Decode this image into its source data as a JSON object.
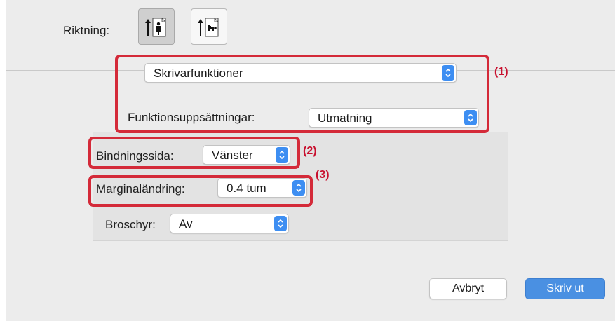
{
  "orientation": {
    "label": "Riktning:",
    "options": [
      {
        "name": "portrait",
        "icon": "portrait-orientation-icon",
        "selected": true
      },
      {
        "name": "landscape",
        "icon": "landscape-orientation-icon",
        "selected": false
      }
    ]
  },
  "section_menu": {
    "value": "Skrivarfunktioner",
    "icon": "popup-arrows-icon"
  },
  "feature_sets": {
    "label": "Funktionsuppsättningar:",
    "value": "Utmatning"
  },
  "binding": {
    "label": "Bindningssida:",
    "value": "Vänster"
  },
  "margin": {
    "label": "Marginaländring:",
    "value": "0.4 tum"
  },
  "booklet": {
    "label": "Broschyr:",
    "value": "Av"
  },
  "callouts": {
    "c1": "(1)",
    "c2": "(2)",
    "c3": "(3)"
  },
  "footer": {
    "cancel_label": "Avbryt",
    "print_label": "Skriv ut"
  },
  "colors": {
    "accent": "#3d8ef2",
    "primary_button": "#4a90e2",
    "highlight": "#d42a39",
    "callout_text": "#c8102e",
    "dialog_bg": "#ececec"
  }
}
